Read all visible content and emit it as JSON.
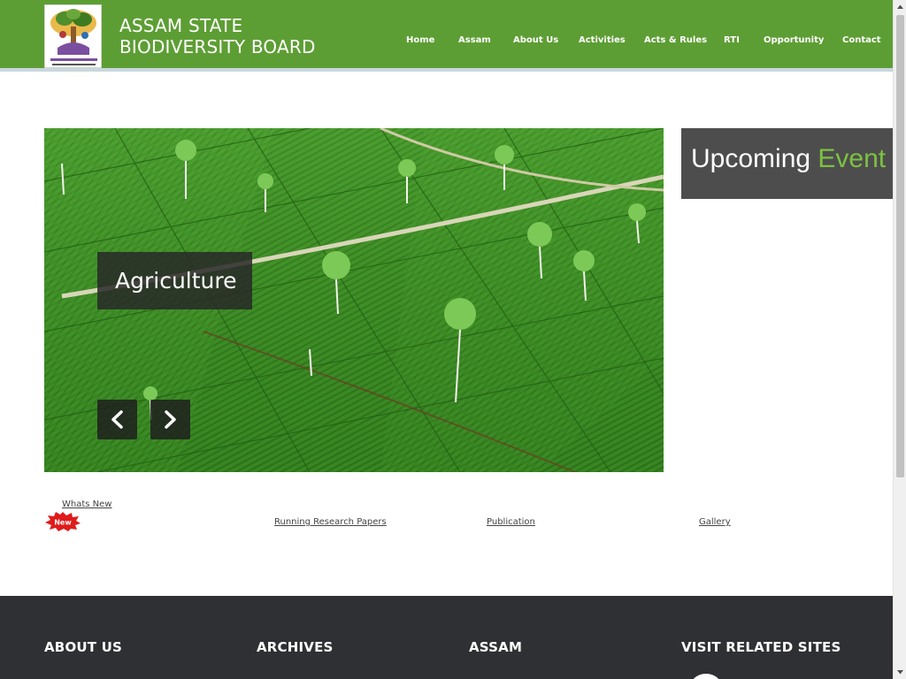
{
  "site": {
    "title_line1": "ASSAM STATE",
    "title_line2": "BIODIVERSITY BOARD",
    "logo_icon": "board-emblem-icon"
  },
  "nav": [
    {
      "label": "Home"
    },
    {
      "label": "Assam"
    },
    {
      "label": "About Us"
    },
    {
      "label": "Activities"
    },
    {
      "label": "Acts & Rules"
    },
    {
      "label": "RTI"
    },
    {
      "label": "Opportunity"
    },
    {
      "label": "Contact"
    }
  ],
  "slider": {
    "caption": "Agriculture",
    "prev_icon": "chevron-left-icon",
    "next_icon": "chevron-right-icon"
  },
  "events": {
    "title_part1": "Upcoming",
    "title_part2": "Event"
  },
  "links": {
    "whats_new": "Whats New",
    "new_badge": "New",
    "research": "Running Research Papers",
    "publication": "Publication",
    "gallery": "Gallery"
  },
  "footer": {
    "about": "ABOUT US",
    "archives": "ARCHIVES",
    "assam": "ASSAM",
    "related": "VISIT RELATED SITES"
  },
  "colors": {
    "header_green": "#5d9e34",
    "accent_green": "#7cc242",
    "footer_bg": "#2f3033",
    "events_bg": "#4d4d4d"
  }
}
